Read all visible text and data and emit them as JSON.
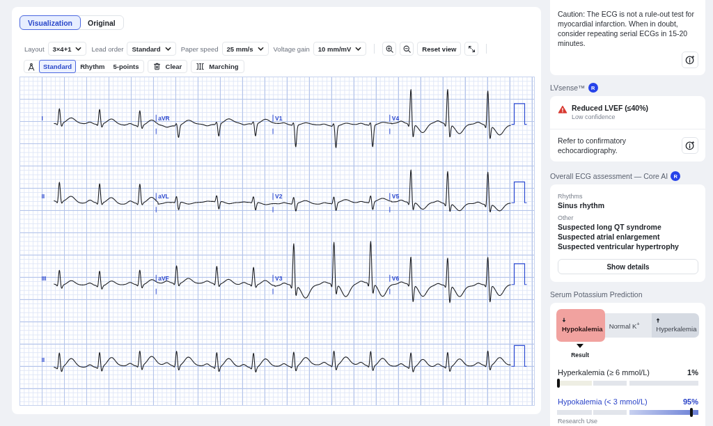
{
  "view_tabs": [
    {
      "label": "Visualization",
      "selected": true
    },
    {
      "label": "Original",
      "selected": false
    }
  ],
  "toolbar": {
    "controls": [
      {
        "label": "Layout",
        "value": "3×4+1"
      },
      {
        "label": "Lead order",
        "value": "Standard"
      },
      {
        "label": "Paper speed",
        "value": "25 mm/s"
      },
      {
        "label": "Voltage gain",
        "value": "10 mm/mV"
      }
    ],
    "reset_button": "Reset view"
  },
  "measure_modes": [
    {
      "label": "Standard",
      "selected": true
    },
    {
      "label": "Rhythm",
      "selected": false
    },
    {
      "label": "5-points",
      "selected": false
    }
  ],
  "actions": [
    {
      "label": "Clear",
      "kind": "clear"
    },
    {
      "label": "Marching",
      "kind": "marching"
    }
  ],
  "ecg": {
    "rows": [
      {
        "leads": [
          "I",
          "aVR",
          "V1",
          "V4"
        ]
      },
      {
        "leads": [
          "II",
          "aVL",
          "V2",
          "V5"
        ]
      },
      {
        "leads": [
          "III",
          "aVF",
          "V3",
          "V6"
        ]
      },
      {
        "leads": [
          "II"
        ]
      }
    ]
  },
  "caution": {
    "text": "Caution: The ECG is not a rule-out test for myocardial infarction. When in doubt, consider repeating serial ECGs in 15-20 minutes."
  },
  "lvsense": {
    "title": "LVsense™",
    "badge": "R",
    "finding": {
      "title": "Reduced LVEF (≤40%)",
      "confidence": "Low confidence"
    },
    "advice": "Refer to confirmatory echocardiography."
  },
  "assessment": {
    "title": "Overall ECG assessment — Core AI",
    "badge": "R",
    "groups": [
      {
        "heading": "Rhythms",
        "items": [
          "Sinus rhythm"
        ]
      },
      {
        "heading": "Other",
        "items": [
          "Suspected long QT syndrome",
          "Suspected atrial enlargement",
          "Suspected ventricular hypertrophy"
        ]
      }
    ],
    "details_button": "Show details"
  },
  "potassium": {
    "title": "Serum Potassium Prediction",
    "categories": [
      {
        "label": "Hypokalemia",
        "kind": "low",
        "selected": true
      },
      {
        "label": "Normal K$^{+}$",
        "kind": "normal",
        "selected": false
      },
      {
        "label": "Hyperkalemia",
        "kind": "high",
        "selected": false
      }
    ],
    "result_label": "Result",
    "risks": [
      {
        "label": "Hyperkalemia (≥ 6 mmol/L)",
        "value": "1%",
        "level": 0.01,
        "highlighted": false
      },
      {
        "label": "Hypokalemia (< 3 mmol/L)",
        "value": "95%",
        "level": 0.95,
        "highlighted": true
      }
    ],
    "footer": "Research Use"
  }
}
